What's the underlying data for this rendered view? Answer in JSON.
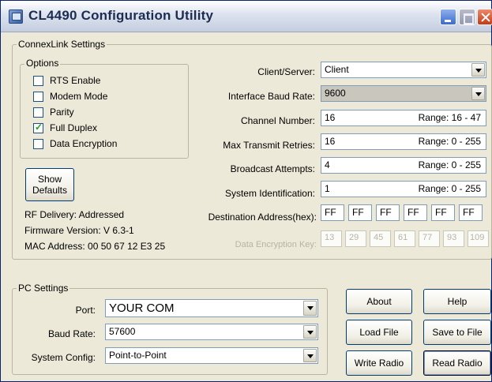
{
  "window": {
    "title": "CL4490 Configuration Utility"
  },
  "connexlink": {
    "group_title": "ConnexLink Settings",
    "options": {
      "group_title": "Options",
      "items": [
        {
          "label": "RTS Enable",
          "checked": false
        },
        {
          "label": "Modem Mode",
          "checked": false
        },
        {
          "label": "Parity",
          "checked": false
        },
        {
          "label": "Full Duplex",
          "checked": true
        },
        {
          "label": "Data Encryption",
          "checked": false
        }
      ]
    },
    "show_defaults_line1": "Show",
    "show_defaults_line2": "Defaults",
    "rf_delivery": "RF Delivery: Addressed",
    "firmware_version": "Firmware Version:  V 6.3-1",
    "mac_address": "MAC Address:  00 50 67 12 E3 25",
    "client_server": {
      "label": "Client/Server:",
      "value": "Client"
    },
    "interface_baud": {
      "label": "Interface Baud Rate:",
      "value": "9600"
    },
    "channel_number": {
      "label": "Channel Number:",
      "value": "16",
      "range": "Range: 16 - 47"
    },
    "max_retries": {
      "label": "Max Transmit Retries:",
      "value": "16",
      "range": "Range: 0 - 255"
    },
    "broadcast_attempts": {
      "label": "Broadcast Attempts:",
      "value": "4",
      "range": "Range: 0 - 255"
    },
    "system_id": {
      "label": "System Identification:",
      "value": "1",
      "range": "Range: 0 - 255"
    },
    "destination": {
      "label": "Destination Address(hex):",
      "values": [
        "FF",
        "FF",
        "FF",
        "FF",
        "FF",
        "FF"
      ]
    },
    "encryption_key": {
      "label": "Data Encryption Key:",
      "values": [
        "13",
        "29",
        "45",
        "61",
        "77",
        "93",
        "109"
      ]
    }
  },
  "pc_settings": {
    "group_title": "PC Settings",
    "port": {
      "label": "Port:",
      "value": "YOUR COM"
    },
    "baud_rate": {
      "label": "Baud Rate:",
      "value": "57600"
    },
    "system_config": {
      "label": "System Config:",
      "value": "Point-to-Point"
    }
  },
  "buttons": {
    "about": "About",
    "help": "Help",
    "load_file": "Load File",
    "save_to_file": "Save to File",
    "write_radio": "Write Radio",
    "read_radio": "Read Radio"
  }
}
